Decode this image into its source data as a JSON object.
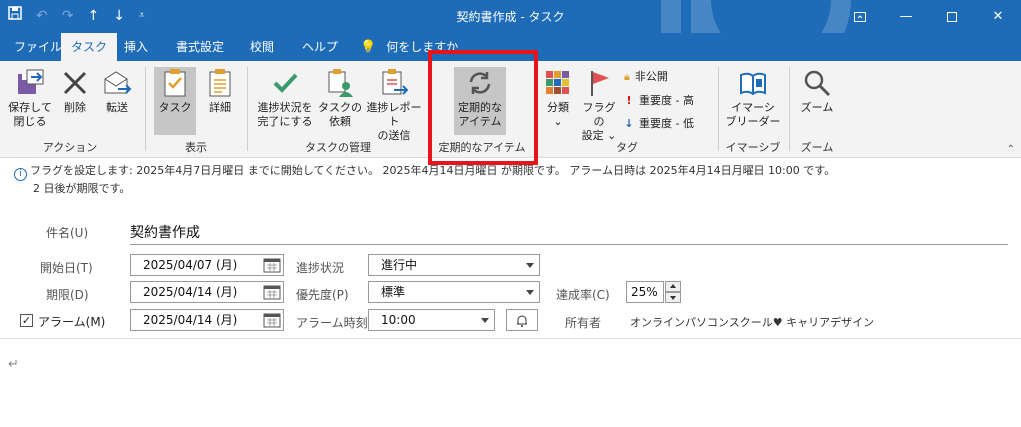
{
  "window": {
    "title": "契約書作成 - タスク",
    "qat_icons": [
      "save-icon",
      "undo-icon",
      "redo-icon",
      "up-arrow-icon",
      "down-arrow-icon",
      "customize-qat-icon"
    ],
    "controls": [
      "ribbon-display-options-icon",
      "minimize-icon",
      "maximize-icon",
      "close-icon"
    ]
  },
  "tabs": [
    {
      "label": "ファイル",
      "active": false
    },
    {
      "label": "タスク",
      "active": true
    },
    {
      "label": "挿入",
      "active": false
    },
    {
      "label": "書式設定",
      "active": false
    },
    {
      "label": "校閲",
      "active": false
    },
    {
      "label": "ヘルプ",
      "active": false
    }
  ],
  "tell_me": "何をしますか",
  "ribbon": {
    "actions": {
      "group_label": "アクション",
      "save_close": [
        "保存して",
        "閉じる"
      ],
      "delete": "削除",
      "forward": "転送"
    },
    "view": {
      "group_label": "表示",
      "task": "タスク",
      "details": "詳細"
    },
    "manage": {
      "group_label": "タスクの管理",
      "mark_complete": [
        "進捗状況を",
        "完了にする"
      ],
      "assign": [
        "タスクの",
        "依頼"
      ],
      "send_report": [
        "進捗レポート",
        "の送信"
      ]
    },
    "recurrence": {
      "group_label": "定期的なアイテム",
      "button": [
        "定期的な",
        "アイテム"
      ]
    },
    "tags": {
      "group_label": "タグ",
      "categorize": "分類",
      "follow_up": [
        "フラグの",
        "設定"
      ],
      "private": "非公開",
      "high": "重要度 - 高",
      "low": "重要度 - 低"
    },
    "immersive": {
      "group_label": "イマーシブ",
      "reader": [
        "イマーシ",
        "ブリーダー"
      ]
    },
    "zoom": {
      "group_label": "ズーム",
      "button": "ズーム"
    }
  },
  "info": {
    "line1": "フラグを設定します: 2025年4月7日月曜日 までに開始してください。 2025年4月14日月曜日 が期限です。 アラーム日時は 2025年4月14日月曜日 10:00 です。",
    "line2": "2 日後が期限です。"
  },
  "form": {
    "subject_label": "件名(U)",
    "subject": "契約書作成",
    "start_label": "開始日(T)",
    "start": "2025/04/07 (月)",
    "due_label": "期限(D)",
    "due": "2025/04/14 (月)",
    "reminder_label": "アラーム(M)",
    "reminder_checked": true,
    "reminder_date": "2025/04/14 (月)",
    "status_label": "進捗状況",
    "status": "進行中",
    "priority_label": "優先度(P)",
    "priority": "標準",
    "time_label": "アラーム時刻",
    "time": "10:00",
    "complete_label": "達成率(C)",
    "complete": "25%",
    "owner_label": "所有者",
    "owner": "オンラインパソコンスクール♥ キャリアデザイン"
  },
  "body": {
    "paragraph_mark": "↵"
  },
  "colors": {
    "accent": "#1e6bb8",
    "highlight_box": "#e8141b"
  }
}
